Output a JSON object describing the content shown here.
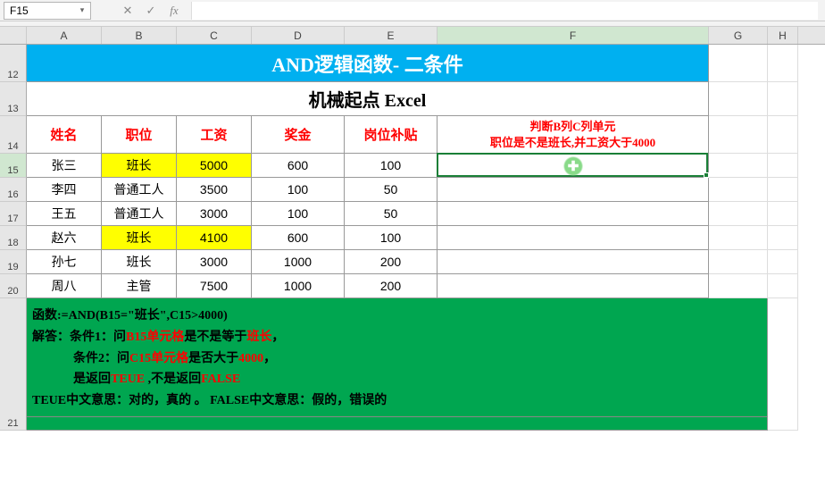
{
  "namebox": {
    "value": "F15"
  },
  "formula_bar": {
    "value": "",
    "fx_label": "fx",
    "cancel": "✕",
    "confirm": "✓"
  },
  "columns": [
    "A",
    "B",
    "C",
    "D",
    "E",
    "F",
    "G",
    "H"
  ],
  "row_numbers": [
    "12",
    "13",
    "14",
    "15",
    "16",
    "17",
    "18",
    "19",
    "20",
    "21"
  ],
  "banner": {
    "title": "AND逻辑函数- 二条件"
  },
  "subtitle": "机械起点 Excel",
  "headers": {
    "name": "姓名",
    "position": "职位",
    "salary": "工资",
    "bonus": "奖金",
    "allowance": "岗位补贴",
    "judge_line1": "判断B列C列单元",
    "judge_line2": "职位是不是班长,并工资大于4000"
  },
  "rows": [
    {
      "name": "张三",
      "pos": "班长",
      "salary": "5000",
      "bonus": "600",
      "allow": "100",
      "hlPos": true,
      "hlSal": true,
      "result": ""
    },
    {
      "name": "李四",
      "pos": "普通工人",
      "salary": "3500",
      "bonus": "100",
      "allow": "50",
      "hlPos": false,
      "hlSal": false,
      "result": ""
    },
    {
      "name": "王五",
      "pos": "普通工人",
      "salary": "3000",
      "bonus": "100",
      "allow": "50",
      "hlPos": false,
      "hlSal": false,
      "result": ""
    },
    {
      "name": "赵六",
      "pos": "班长",
      "salary": "4100",
      "bonus": "600",
      "allow": "100",
      "hlPos": true,
      "hlSal": true,
      "result": ""
    },
    {
      "name": "孙七",
      "pos": "班长",
      "salary": "3000",
      "bonus": "1000",
      "allow": "200",
      "hlPos": false,
      "hlSal": false,
      "result": ""
    },
    {
      "name": "周八",
      "pos": "主管",
      "salary": "7500",
      "bonus": "1000",
      "allow": "200",
      "hlPos": false,
      "hlSal": false,
      "result": ""
    }
  ],
  "explain": {
    "l1a": "函数:=AND(B15=\"班长\",C15>4000)",
    "l2a": "解答：条件1：问",
    "l2b": "B15单元格",
    "l2c": "是不是等于",
    "l2d": "班长",
    "l2e": "，",
    "l3a": "条件2：问",
    "l3b": "C15单元格",
    "l3c": "是否大于",
    "l3d": "4000",
    "l3e": "，",
    "l4a": "是返回",
    "l4b": "TEUE",
    "l4c": " ,不是返回",
    "l4d": "FALSE",
    "l5": "TEUE中文意思：对的，真的 。 FALSE中文意思：假的，错误的"
  },
  "active_cell": "F15"
}
